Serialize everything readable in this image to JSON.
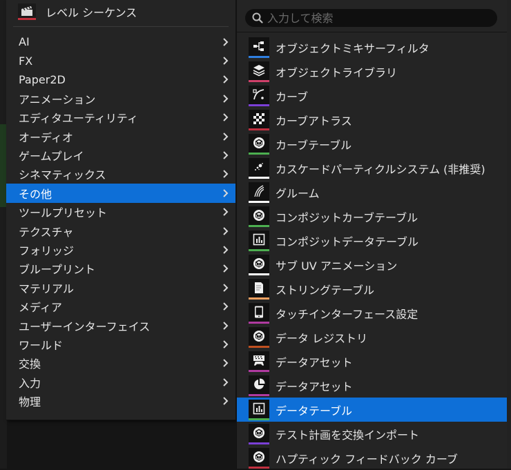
{
  "top_item": {
    "label": "レベル シーケンス"
  },
  "categories": [
    {
      "label": "AI"
    },
    {
      "label": "FX"
    },
    {
      "label": "Paper2D"
    },
    {
      "label": "アニメーション"
    },
    {
      "label": "エディタユーティリティ"
    },
    {
      "label": "オーディオ"
    },
    {
      "label": "ゲームプレイ"
    },
    {
      "label": "シネマティックス"
    },
    {
      "label": "その他",
      "selected": true
    },
    {
      "label": "ツールプリセット"
    },
    {
      "label": "テクスチャ"
    },
    {
      "label": "フォリッジ"
    },
    {
      "label": "ブループリント"
    },
    {
      "label": "マテリアル"
    },
    {
      "label": "メディア"
    },
    {
      "label": "ユーザーインターフェイス"
    },
    {
      "label": "ワールド"
    },
    {
      "label": "交換"
    },
    {
      "label": "入力"
    },
    {
      "label": "物理"
    }
  ],
  "search": {
    "placeholder": "入力して検索",
    "value": ""
  },
  "assets": [
    {
      "label": "オブジェクトミキサーフィルタ",
      "icon": "node-graph-icon",
      "color": "#2f7fe0"
    },
    {
      "label": "オブジェクトライブラリ",
      "icon": "layers-icon",
      "color": "#d0406a"
    },
    {
      "label": "カーブ",
      "icon": "curve-icon",
      "color": "#7b3fd6"
    },
    {
      "label": "カーブアトラス",
      "icon": "checker-icon",
      "color": "#c03040"
    },
    {
      "label": "カーブテーブル",
      "icon": "cube-icon",
      "color": "#4caf50"
    },
    {
      "label": "カスケードパーティクルシステム (非推奨)",
      "icon": "particle-icon",
      "color": "#ffffff"
    },
    {
      "label": "グルーム",
      "icon": "hair-icon",
      "color": "#ffffff"
    },
    {
      "label": "コンポジットカーブテーブル",
      "icon": "cube-icon",
      "color": "#4caf50"
    },
    {
      "label": "コンポジットデータテーブル",
      "icon": "table-chart-icon",
      "color": "#4caf50"
    },
    {
      "label": "サブ UV アニメーション",
      "icon": "cube-icon",
      "color": "#ffffff"
    },
    {
      "label": "ストリングテーブル",
      "icon": "document-icon",
      "color": "#f0a060"
    },
    {
      "label": "タッチインターフェース設定",
      "icon": "tablet-icon",
      "color": "#b03aa0"
    },
    {
      "label": "データ レジストリ",
      "icon": "cube-icon",
      "color": "#c05020"
    },
    {
      "label": "データアセット",
      "icon": "gamepad-icon",
      "color": "#b03aa0"
    },
    {
      "label": "データアセット",
      "icon": "pie-chart-icon",
      "color": "#b03aa0"
    },
    {
      "label": "データテーブル",
      "icon": "table-chart-icon",
      "color": "#4caf50",
      "selected": true
    },
    {
      "label": "テスト計画を交換インポート",
      "icon": "cube-icon",
      "color": "#7b3fd6"
    },
    {
      "label": "ハプティック フィードバック カーブ",
      "icon": "cube-icon",
      "color": "#c03040"
    }
  ],
  "colors": {
    "accent": "#0e6fd7",
    "menu_bg": "#242424"
  }
}
